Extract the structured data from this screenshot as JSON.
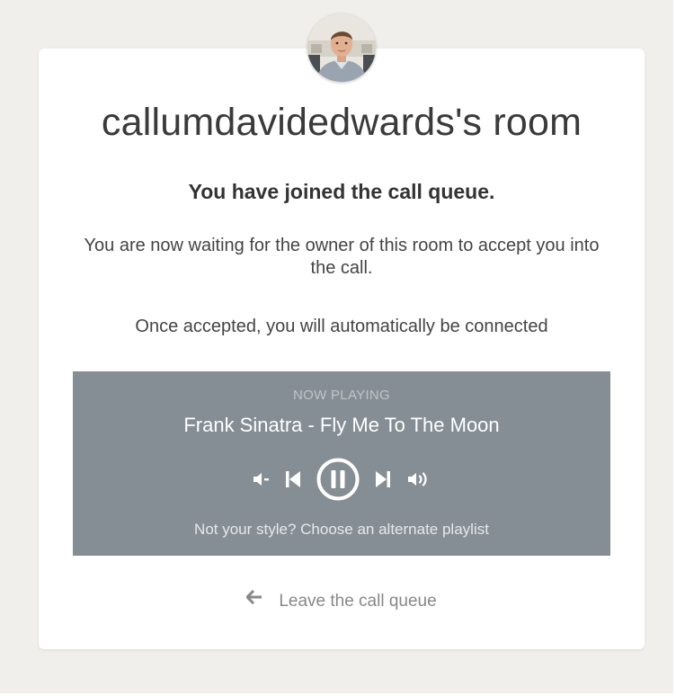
{
  "room": {
    "title": "callumdavidedwards's room",
    "avatar_icon": "owner-avatar"
  },
  "queue": {
    "joined_message": "You have joined the call queue.",
    "waiting_message": "You are now waiting for the owner of this room to accept you into the call.",
    "connected_message": "Once accepted, you will automatically be connected"
  },
  "player": {
    "now_playing_label": "NOW PLAYING",
    "track": "Frank Sinatra - Fly Me To The Moon",
    "state": "playing",
    "controls": {
      "volume_down_icon": "volume-down-icon",
      "previous_icon": "skip-previous-icon",
      "pause_icon": "pause-circle-icon",
      "next_icon": "skip-next-icon",
      "volume_up_icon": "volume-up-icon"
    },
    "alternate_playlist_link": "Not your style? Choose an alternate playlist",
    "background_color": "#858e94"
  },
  "leave": {
    "icon": "arrow-left-icon",
    "label": "Leave the call queue"
  },
  "colors": {
    "page_background": "#f0efeb",
    "card_background": "#ffffff",
    "title_text": "#3a3a3a",
    "muted_text": "#888888"
  }
}
